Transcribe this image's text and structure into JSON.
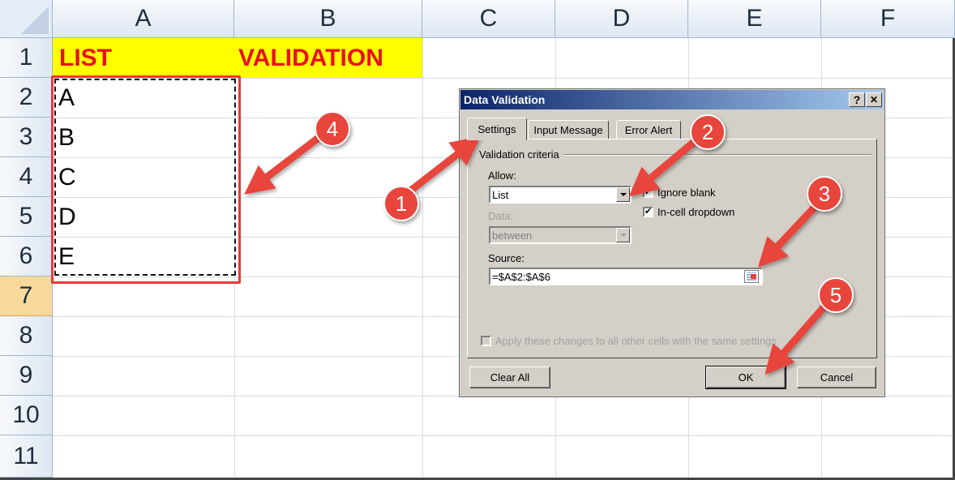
{
  "sheet": {
    "columns": [
      "A",
      "B",
      "C",
      "D",
      "E",
      "F"
    ],
    "rows": [
      "1",
      "2",
      "3",
      "4",
      "5",
      "6",
      "7",
      "8",
      "9",
      "10",
      "11"
    ],
    "active_row": "7",
    "cells": {
      "A1": "LIST",
      "B1": "VALIDATION",
      "A2": "A",
      "A3": "B",
      "A4": "C",
      "A5": "D",
      "A6": "E"
    },
    "header_fill_color": "#ffff00",
    "header_text_color": "#e8101a"
  },
  "dialog": {
    "title": "Data Validation",
    "help_button": "?",
    "close_button": "✕",
    "tabs": [
      "Settings",
      "Input Message",
      "Error Alert"
    ],
    "active_tab": "Settings",
    "group_label": "Validation criteria",
    "allow_label": "Allow:",
    "allow_value": "List",
    "ignore_blank_label": "Ignore blank",
    "ignore_blank_checked": true,
    "in_cell_dropdown_label": "In-cell dropdown",
    "in_cell_dropdown_checked": true,
    "data_label": "Data:",
    "data_value": "between",
    "source_label": "Source:",
    "source_value": "=$A$2:$A$6",
    "apply_all_label": "Apply these changes to all other cells with the same settings",
    "clear_all_button": "Clear All",
    "ok_button": "OK",
    "cancel_button": "Cancel"
  },
  "annotations": {
    "badges": [
      "1",
      "2",
      "3",
      "4",
      "5"
    ],
    "color": "#e8453c"
  }
}
